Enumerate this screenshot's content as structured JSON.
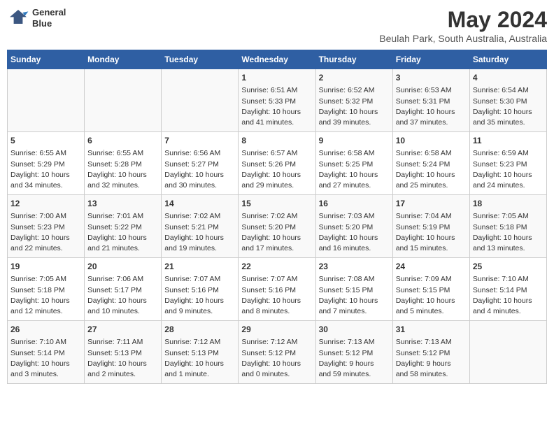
{
  "header": {
    "logo_line1": "General",
    "logo_line2": "Blue",
    "title": "May 2024",
    "subtitle": "Beulah Park, South Australia, Australia"
  },
  "weekdays": [
    "Sunday",
    "Monday",
    "Tuesday",
    "Wednesday",
    "Thursday",
    "Friday",
    "Saturday"
  ],
  "weeks": [
    {
      "days": [
        {
          "num": "",
          "info": ""
        },
        {
          "num": "",
          "info": ""
        },
        {
          "num": "",
          "info": ""
        },
        {
          "num": "1",
          "info": "Sunrise: 6:51 AM\nSunset: 5:33 PM\nDaylight: 10 hours\nand 41 minutes."
        },
        {
          "num": "2",
          "info": "Sunrise: 6:52 AM\nSunset: 5:32 PM\nDaylight: 10 hours\nand 39 minutes."
        },
        {
          "num": "3",
          "info": "Sunrise: 6:53 AM\nSunset: 5:31 PM\nDaylight: 10 hours\nand 37 minutes."
        },
        {
          "num": "4",
          "info": "Sunrise: 6:54 AM\nSunset: 5:30 PM\nDaylight: 10 hours\nand 35 minutes."
        }
      ]
    },
    {
      "days": [
        {
          "num": "5",
          "info": "Sunrise: 6:55 AM\nSunset: 5:29 PM\nDaylight: 10 hours\nand 34 minutes."
        },
        {
          "num": "6",
          "info": "Sunrise: 6:55 AM\nSunset: 5:28 PM\nDaylight: 10 hours\nand 32 minutes."
        },
        {
          "num": "7",
          "info": "Sunrise: 6:56 AM\nSunset: 5:27 PM\nDaylight: 10 hours\nand 30 minutes."
        },
        {
          "num": "8",
          "info": "Sunrise: 6:57 AM\nSunset: 5:26 PM\nDaylight: 10 hours\nand 29 minutes."
        },
        {
          "num": "9",
          "info": "Sunrise: 6:58 AM\nSunset: 5:25 PM\nDaylight: 10 hours\nand 27 minutes."
        },
        {
          "num": "10",
          "info": "Sunrise: 6:58 AM\nSunset: 5:24 PM\nDaylight: 10 hours\nand 25 minutes."
        },
        {
          "num": "11",
          "info": "Sunrise: 6:59 AM\nSunset: 5:23 PM\nDaylight: 10 hours\nand 24 minutes."
        }
      ]
    },
    {
      "days": [
        {
          "num": "12",
          "info": "Sunrise: 7:00 AM\nSunset: 5:23 PM\nDaylight: 10 hours\nand 22 minutes."
        },
        {
          "num": "13",
          "info": "Sunrise: 7:01 AM\nSunset: 5:22 PM\nDaylight: 10 hours\nand 21 minutes."
        },
        {
          "num": "14",
          "info": "Sunrise: 7:02 AM\nSunset: 5:21 PM\nDaylight: 10 hours\nand 19 minutes."
        },
        {
          "num": "15",
          "info": "Sunrise: 7:02 AM\nSunset: 5:20 PM\nDaylight: 10 hours\nand 17 minutes."
        },
        {
          "num": "16",
          "info": "Sunrise: 7:03 AM\nSunset: 5:20 PM\nDaylight: 10 hours\nand 16 minutes."
        },
        {
          "num": "17",
          "info": "Sunrise: 7:04 AM\nSunset: 5:19 PM\nDaylight: 10 hours\nand 15 minutes."
        },
        {
          "num": "18",
          "info": "Sunrise: 7:05 AM\nSunset: 5:18 PM\nDaylight: 10 hours\nand 13 minutes."
        }
      ]
    },
    {
      "days": [
        {
          "num": "19",
          "info": "Sunrise: 7:05 AM\nSunset: 5:18 PM\nDaylight: 10 hours\nand 12 minutes."
        },
        {
          "num": "20",
          "info": "Sunrise: 7:06 AM\nSunset: 5:17 PM\nDaylight: 10 hours\nand 10 minutes."
        },
        {
          "num": "21",
          "info": "Sunrise: 7:07 AM\nSunset: 5:16 PM\nDaylight: 10 hours\nand 9 minutes."
        },
        {
          "num": "22",
          "info": "Sunrise: 7:07 AM\nSunset: 5:16 PM\nDaylight: 10 hours\nand 8 minutes."
        },
        {
          "num": "23",
          "info": "Sunrise: 7:08 AM\nSunset: 5:15 PM\nDaylight: 10 hours\nand 7 minutes."
        },
        {
          "num": "24",
          "info": "Sunrise: 7:09 AM\nSunset: 5:15 PM\nDaylight: 10 hours\nand 5 minutes."
        },
        {
          "num": "25",
          "info": "Sunrise: 7:10 AM\nSunset: 5:14 PM\nDaylight: 10 hours\nand 4 minutes."
        }
      ]
    },
    {
      "days": [
        {
          "num": "26",
          "info": "Sunrise: 7:10 AM\nSunset: 5:14 PM\nDaylight: 10 hours\nand 3 minutes."
        },
        {
          "num": "27",
          "info": "Sunrise: 7:11 AM\nSunset: 5:13 PM\nDaylight: 10 hours\nand 2 minutes."
        },
        {
          "num": "28",
          "info": "Sunrise: 7:12 AM\nSunset: 5:13 PM\nDaylight: 10 hours\nand 1 minute."
        },
        {
          "num": "29",
          "info": "Sunrise: 7:12 AM\nSunset: 5:12 PM\nDaylight: 10 hours\nand 0 minutes."
        },
        {
          "num": "30",
          "info": "Sunrise: 7:13 AM\nSunset: 5:12 PM\nDaylight: 9 hours\nand 59 minutes."
        },
        {
          "num": "31",
          "info": "Sunrise: 7:13 AM\nSunset: 5:12 PM\nDaylight: 9 hours\nand 58 minutes."
        },
        {
          "num": "",
          "info": ""
        }
      ]
    }
  ]
}
